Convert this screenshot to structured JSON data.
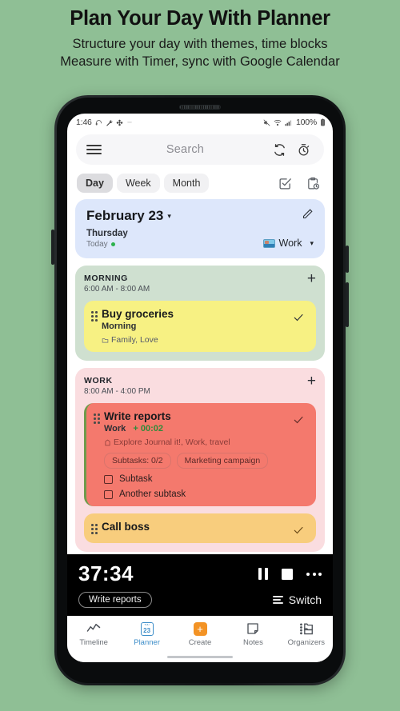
{
  "promo": {
    "title": "Plan Your Day With Planner",
    "subtitle_line1": "Structure your day with themes, time blocks",
    "subtitle_line2": "Measure with Timer, sync with Google Calendar"
  },
  "status_bar": {
    "time": "1:46",
    "left_icons": [
      "headphone-icon",
      "wrench-icon",
      "fan-icon",
      "dash-icon"
    ],
    "right_icons": [
      "mute-icon",
      "wifi-icon",
      "signal-icon"
    ],
    "battery": "100%",
    "battery_icon": "battery-icon"
  },
  "search": {
    "menu_icon": "hamburger-menu-icon",
    "placeholder": "Search",
    "sync_icon": "sync-icon",
    "timer_icon": "stopwatch-icon"
  },
  "view_tabs": {
    "items": [
      {
        "label": "Day",
        "active": true
      },
      {
        "label": "Week",
        "active": false
      },
      {
        "label": "Month",
        "active": false
      }
    ],
    "actions": [
      "checkbox-checked-icon",
      "clipboard-clock-icon"
    ]
  },
  "date_card": {
    "title": "February 23",
    "caret": "▾",
    "edit_icon": "pencil-icon",
    "day_of_week": "Thursday",
    "today_label": "Today",
    "theme_label": "Work",
    "theme_caret": "▾"
  },
  "sections": [
    {
      "name": "MORNING",
      "time_range": "6:00 AM - 8:00 AM",
      "add_icon": "plus-icon",
      "bg": "#cfe0d0",
      "tasks": [
        {
          "title": "Buy groceries",
          "subtitle": "Morning",
          "timer": "",
          "tags": "Family,  Love",
          "tag_items": [
            "Family",
            "Love"
          ],
          "color": "#f7f183",
          "check_icon": "check-icon"
        }
      ]
    },
    {
      "name": "WORK",
      "time_range": "8:00 AM - 4:00 PM",
      "add_icon": "plus-icon",
      "bg": "#fadde0",
      "tasks": [
        {
          "title": "Write reports",
          "subtitle": "Work",
          "timer": "+ 00:02",
          "tags": "Explore Journal it!,  Work,  travel",
          "tag_items": [
            "Explore Journal it!",
            "Work",
            "travel"
          ],
          "color": "#f4796d",
          "check_icon": "check-icon",
          "pills": [
            "Subtasks: 0/2",
            "Marketing campaign"
          ],
          "subtasks": [
            {
              "label": "Subtask",
              "checked": false
            },
            {
              "label": "Another subtask",
              "checked": false
            }
          ]
        },
        {
          "title": "Call boss",
          "subtitle": "",
          "timer": "",
          "tags": "",
          "tag_items": [],
          "color": "#f8cd7d",
          "check_icon": "check-icon"
        }
      ]
    }
  ],
  "timer_bar": {
    "elapsed": "37:34",
    "task_chip": "Write reports",
    "pause_icon": "pause-icon",
    "stop_icon": "stop-icon",
    "more_icon": "more-options-icon",
    "switch_label": "Switch",
    "switch_icon": "list-icon"
  },
  "bottom_nav": {
    "items": [
      {
        "label": "Timeline",
        "icon": "timeline-chart-icon",
        "active": false
      },
      {
        "label": "Planner",
        "icon": "calendar-23-icon",
        "active": true,
        "day_number": "23",
        "day_abbr": "THU"
      },
      {
        "label": "Create",
        "icon": "plus-square-icon",
        "active": false,
        "plus": "+"
      },
      {
        "label": "Notes",
        "icon": "note-icon",
        "active": false
      },
      {
        "label": "Organizers",
        "icon": "folders-icon",
        "active": false
      }
    ]
  },
  "colors": {
    "page_bg": "#8fbf95",
    "date_card_bg": "#dde7fb",
    "morning_bg": "#cfe0d0",
    "work_bg": "#fadde0",
    "task_yellow": "#f7f183",
    "task_red": "#f4796d",
    "task_orange": "#f8cd7d",
    "accent_blue": "#3c8dc8",
    "accent_orange": "#f39325",
    "timer_green": "#2f8b3a"
  }
}
